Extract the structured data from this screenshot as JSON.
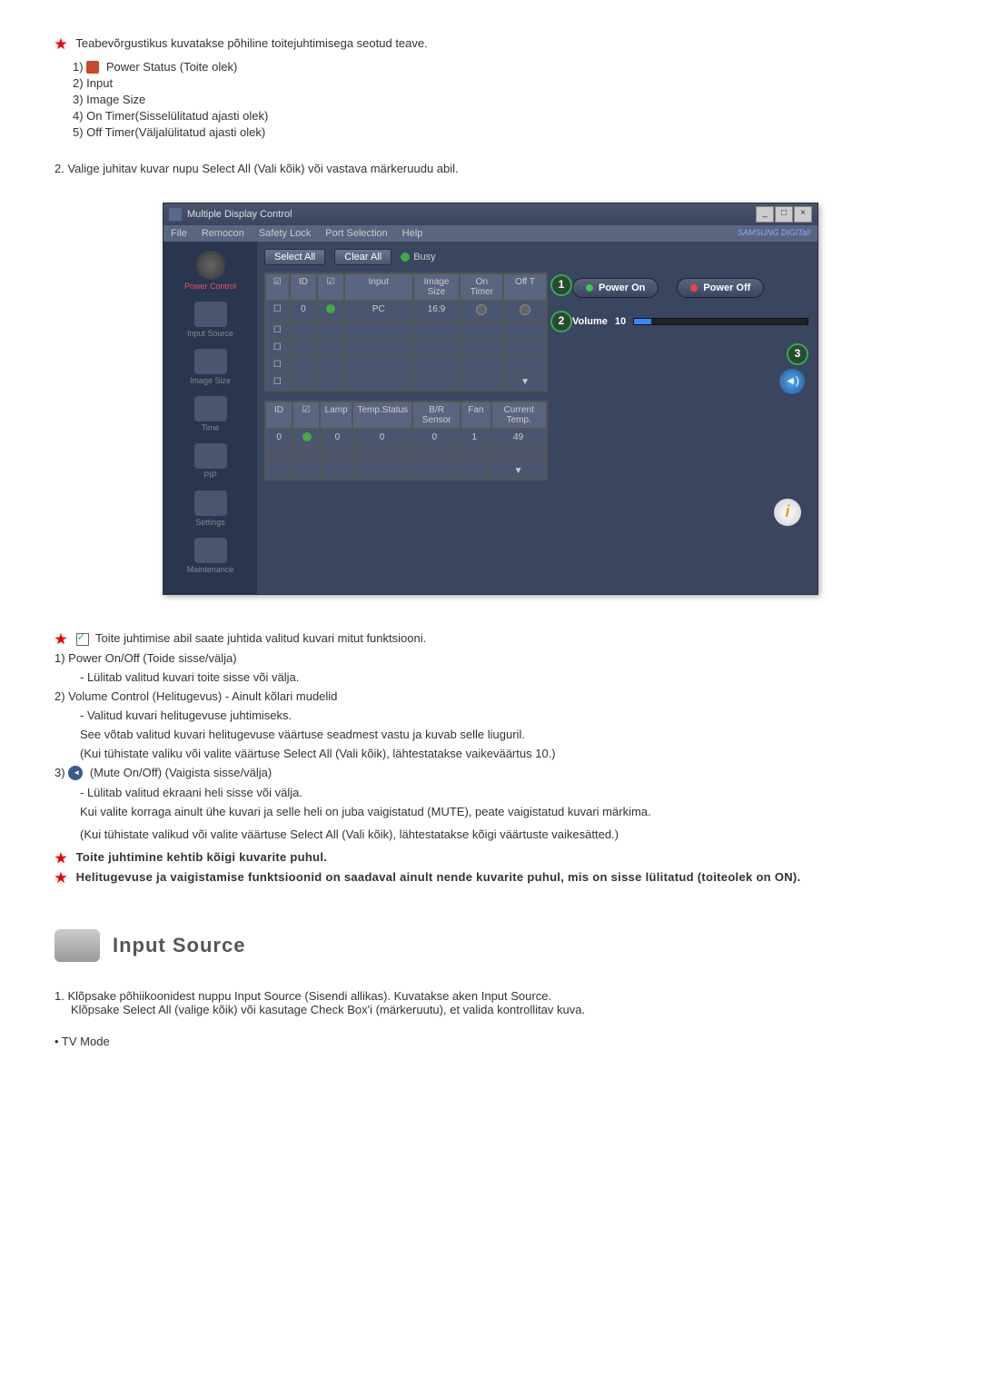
{
  "intro": {
    "line": "Teabevõrgustikus kuvatakse põhiline toitejuhtimisega seotud teave.",
    "items": [
      "1)",
      "2) Input",
      "3) Image Size",
      "4) On Timer(Sisselülitatud ajasti olek)",
      "5) Off Timer(Väljalülitatud ajasti olek)"
    ],
    "item1_suffix": " Power Status (Toite olek)"
  },
  "step2": "2.  Valige juhitav kuvar nupu Select All (Vali kõik) või vastava märkeruudu abil.",
  "app": {
    "title": "Multiple Display Control",
    "menu": [
      "File",
      "Remocon",
      "Safety Lock",
      "Port Selection",
      "Help"
    ],
    "brand": "SAMSUNG DIGITall",
    "selectAll": "Select All",
    "clearAll": "Clear All",
    "busy": "Busy",
    "sidebar": [
      {
        "label": "Power Control",
        "active": true
      },
      {
        "label": "Input Source"
      },
      {
        "label": "Image Size"
      },
      {
        "label": "Time"
      },
      {
        "label": "PIP"
      },
      {
        "label": "Settings"
      },
      {
        "label": "Maintenance"
      }
    ],
    "grid1": {
      "headers": [
        "",
        "ID",
        "",
        "Input",
        "Image Size",
        "On Timer",
        "Off T"
      ],
      "row": {
        "id": "0",
        "input": "PC",
        "size": "16:9"
      }
    },
    "grid2": {
      "headers": [
        "ID",
        "",
        "Lamp",
        "Temp.Status",
        "B/R Sensor",
        "Fan",
        "Current Temp."
      ],
      "row": {
        "id": "0",
        "lamp": "0",
        "temp": "0",
        "br": "0",
        "fan": "1",
        "ct": "49"
      }
    },
    "powerOn": "Power On",
    "powerOff": "Power Off",
    "volumeLabel": "Volume",
    "volumeVal": "10",
    "callouts": [
      "1",
      "2",
      "3"
    ]
  },
  "desc": {
    "lead": "Toite juhtimise abil saate juhtida valitud kuvari mitut funktsiooni.",
    "l1": "1)  Power On/Off (Toide sisse/välja)",
    "l1a": "- Lülitab valitud kuvari toite sisse või välja.",
    "l2": "2)  Volume Control (Helitugevus) - Ainult kõlari mudelid",
    "l2a": "- Valitud kuvari helitugevuse juhtimiseks.",
    "l2b": "See võtab valitud kuvari helitugevuse väärtuse seadmest vastu ja kuvab selle liuguril.",
    "l2c": "(Kui tühistate valiku või valite väärtuse Select All (Vali kõik), lähtestatakse vaikeväärtus 10.)",
    "l3": "3)",
    "l3_suffix": " (Mute On/Off) (Vaigista sisse/välja)",
    "l3a": "- Lülitab valitud ekraani heli sisse või välja.",
    "l3b": "Kui valite korraga ainult ühe kuvari ja selle heli on juba vaigistatud (MUTE), peate vaigistatud kuvari märkima.",
    "l3c": "(Kui tühistate valikud või valite väärtuse Select All (Vali kõik), lähtestatakse kõigi väärtuste vaikesätted.)",
    "note1": "Toite juhtimine kehtib kõigi kuvarite puhul.",
    "note2": "Helitugevuse ja vaigistamise funktsioonid on saadaval ainult nende kuvarite puhul, mis on sisse lülitatud (toiteolek on ON)."
  },
  "section2": {
    "title": "Input Source",
    "p1": "1.  Klõpsake põhiikoonidest nuppu Input Source (Sisendi allikas). Kuvatakse aken Input Source.",
    "p1b": "Klõpsake Select All (valige kõik) või kasutage Check Box'i (märkeruutu), et valida kontrollitav kuva.",
    "tv": "• TV Mode"
  }
}
